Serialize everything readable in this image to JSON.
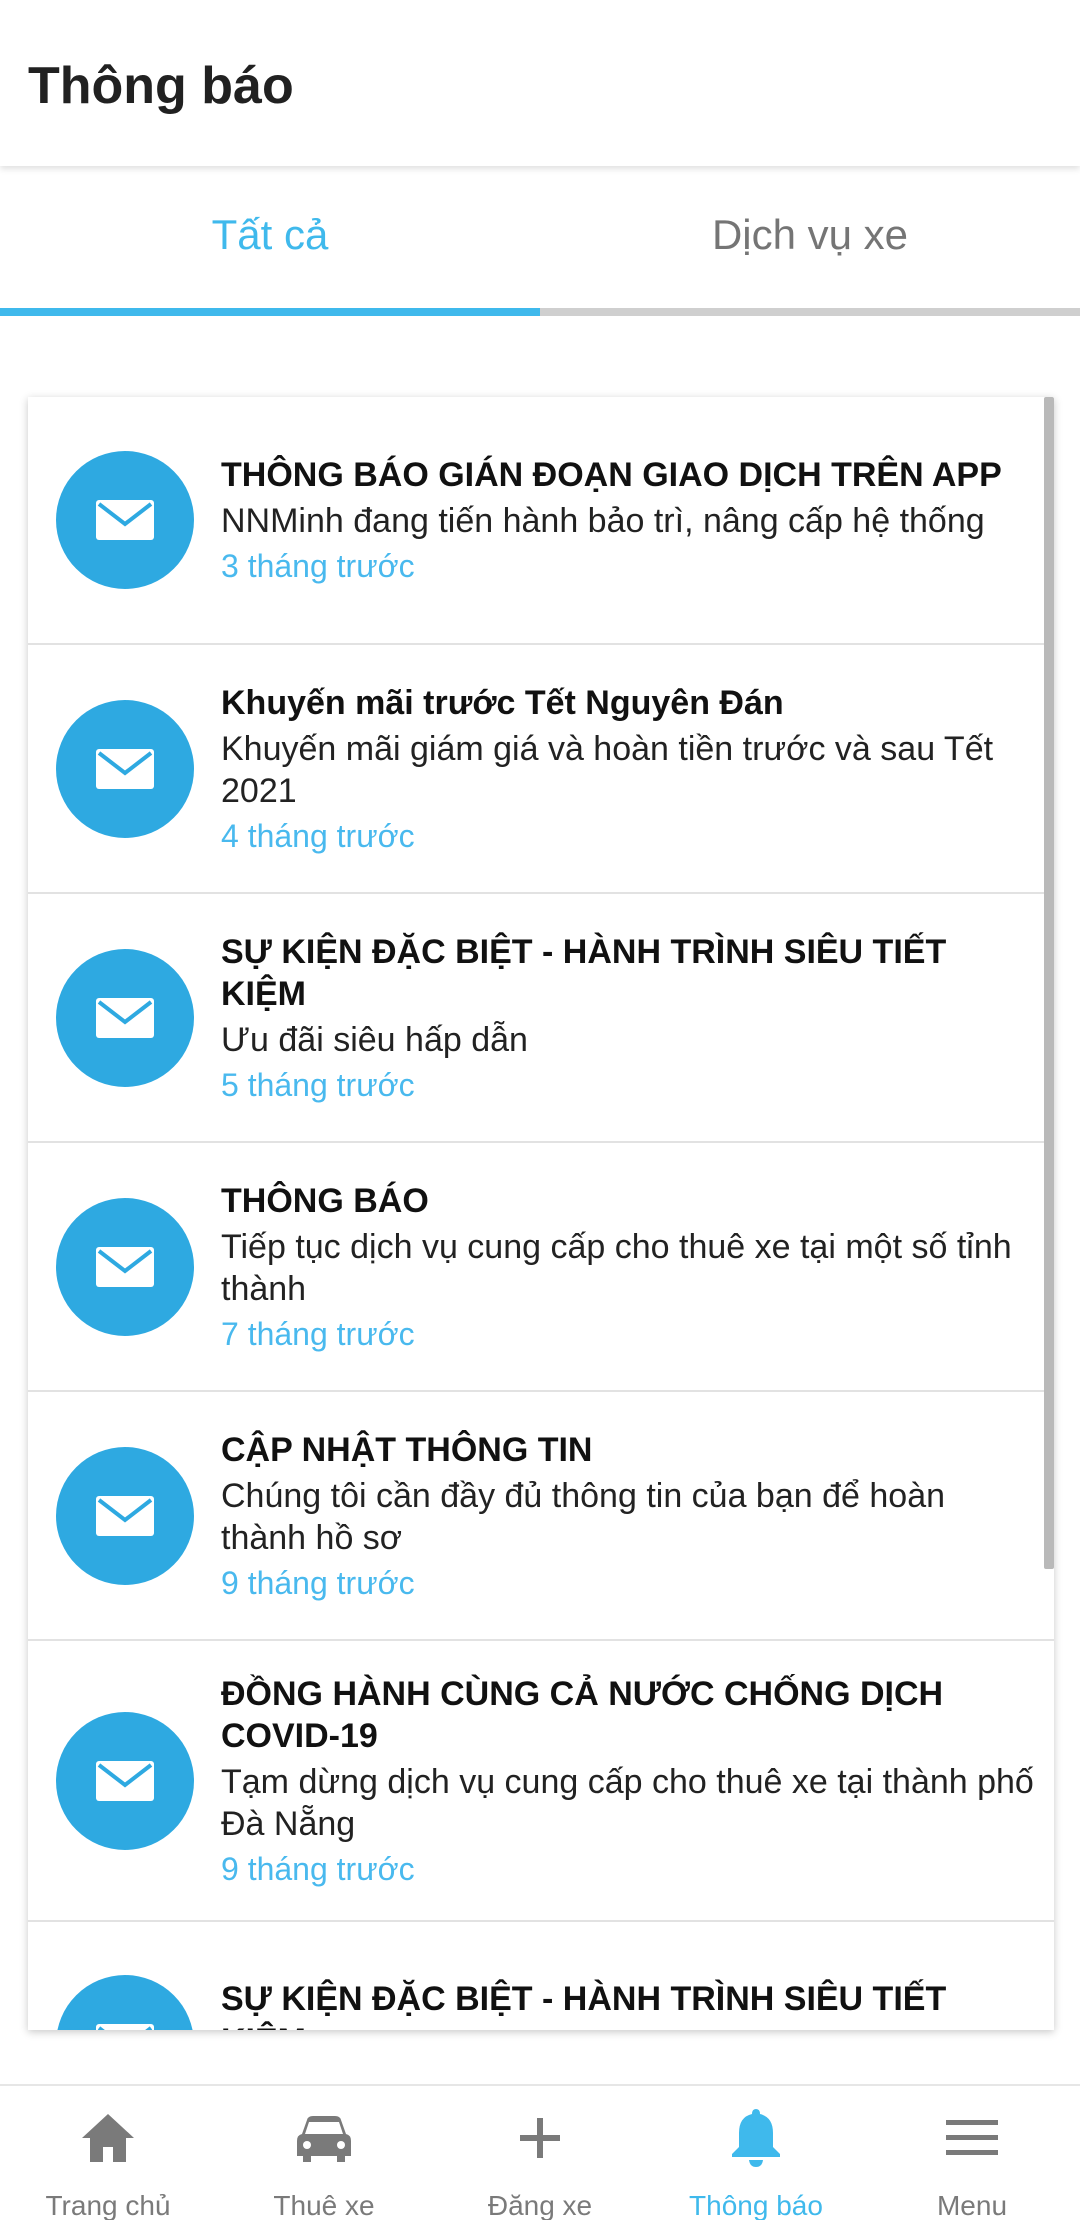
{
  "header": {
    "title": "Thông báo"
  },
  "tabs": [
    {
      "label": "Tất cả",
      "active": true
    },
    {
      "label": "Dịch vụ xe",
      "active": false
    }
  ],
  "colors": {
    "accent": "#3fb9ec",
    "avatar": "#2ea9e1",
    "time": "#49b9ee"
  },
  "notifications": [
    {
      "title": "THÔNG BÁO GIÁN ĐOẠN GIAO DỊCH TRÊN APP",
      "body": "NNMinh đang tiến hành bảo trì, nâng cấp hệ thống",
      "time": "3 tháng trước",
      "icon": "mail-icon"
    },
    {
      "title": "Khuyến mãi trước Tết Nguyên Đán",
      "body": "Khuyến mãi giám giá và hoàn tiền trước và sau Tết 2021",
      "time": "4 tháng trước",
      "icon": "mail-icon"
    },
    {
      "title": "SỰ KIỆN ĐẶC BIỆT - HÀNH TRÌNH SIÊU TIẾT KIỆM",
      "body": "Ưu đãi siêu hấp dẫn",
      "time": "5 tháng trước",
      "icon": "mail-icon"
    },
    {
      "title": "THÔNG BÁO",
      "body": "Tiếp tục dịch vụ cung cấp cho thuê xe tại một số tỉnh thành",
      "time": "7 tháng trước",
      "icon": "mail-icon"
    },
    {
      "title": "CẬP NHẬT THÔNG TIN",
      "body": "Chúng tôi cần đầy đủ thông tin của bạn để hoàn thành hồ sơ",
      "time": "9 tháng trước",
      "icon": "mail-icon"
    },
    {
      "title": "ĐỒNG HÀNH CÙNG CẢ NƯỚC CHỐNG DỊCH COVID-19",
      "body": "Tạm dừng dịch vụ cung cấp cho thuê xe tại thành phố Đà Nẵng",
      "time": "9 tháng trước",
      "icon": "mail-icon"
    },
    {
      "title": "SỰ KIỆN ĐẶC BIỆT - HÀNH TRÌNH SIÊU TIẾT KIỆM",
      "body": "",
      "time": "",
      "icon": "mail-icon"
    }
  ],
  "bottom_nav": [
    {
      "label": "Trang chủ",
      "icon": "home-icon",
      "active": false
    },
    {
      "label": "Thuê xe",
      "icon": "car-icon",
      "active": false
    },
    {
      "label": "Đăng xe",
      "icon": "plus-icon",
      "active": false
    },
    {
      "label": "Thông báo",
      "icon": "bell-icon",
      "active": true
    },
    {
      "label": "Menu",
      "icon": "menu-icon",
      "active": false
    }
  ]
}
